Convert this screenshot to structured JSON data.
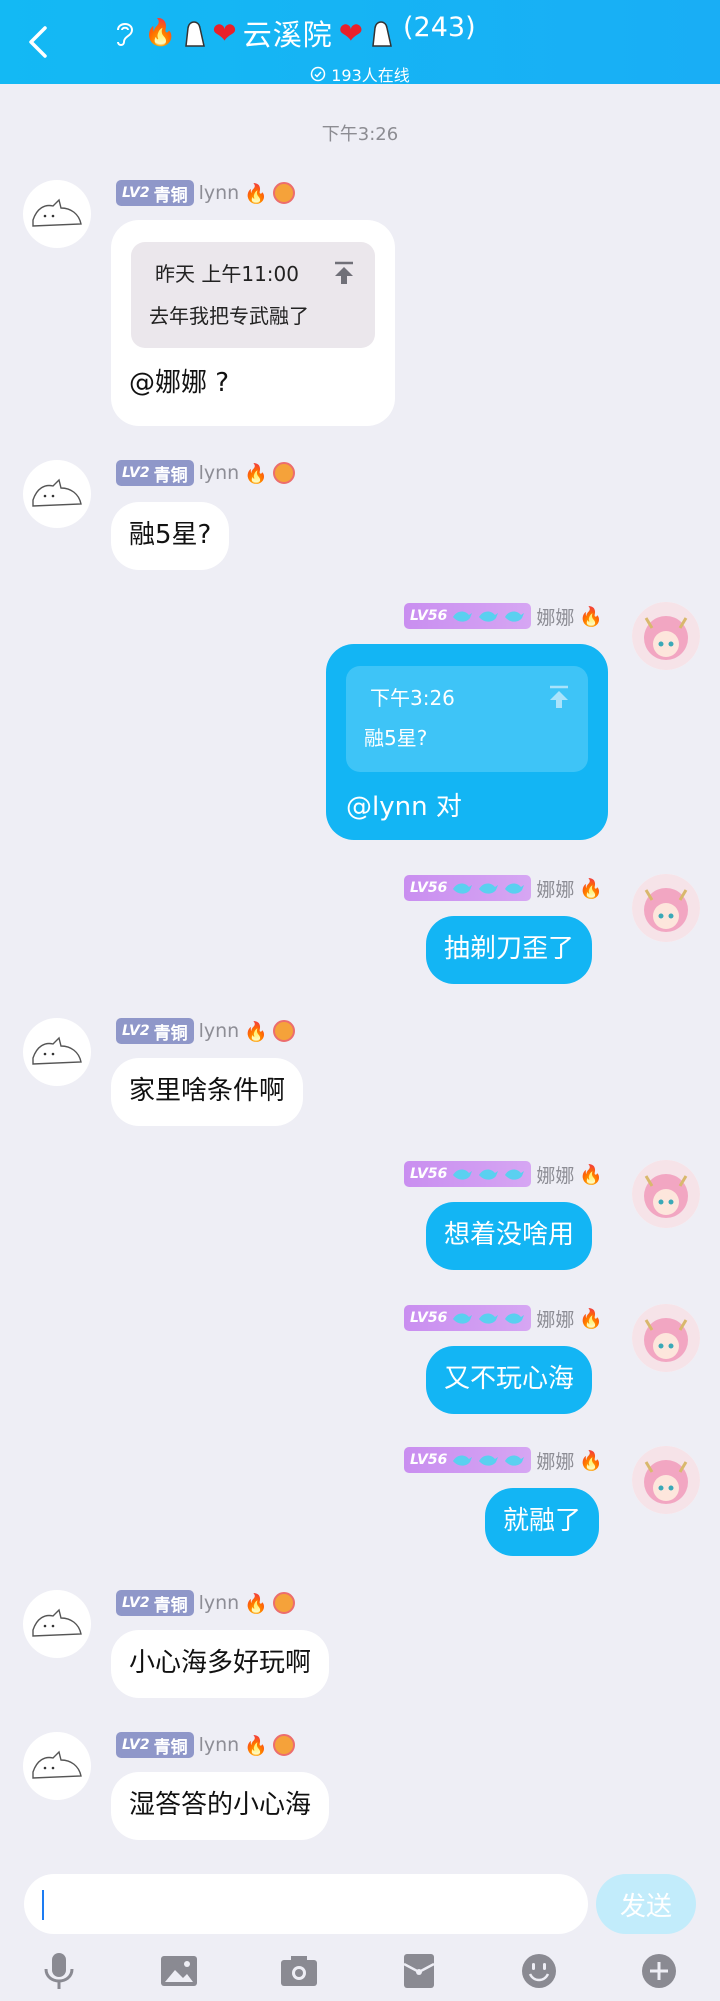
{
  "header": {
    "title": "云溪院",
    "member_count": "(243)",
    "online": "193人在线"
  },
  "timestamp": "下午3:26",
  "users": {
    "lynn": {
      "name": "lynn",
      "level": "LV2",
      "rank": "青铜"
    },
    "nana": {
      "name": "娜娜",
      "level": "LV56"
    }
  },
  "messages": [
    {
      "sender": "lynn",
      "quote_time": "昨天 上午11:00",
      "quote_text": "去年我把专武融了",
      "text": "@娜娜 ?"
    },
    {
      "sender": "lynn",
      "text": "融5星?"
    },
    {
      "sender": "nana",
      "quote_time": "下午3:26",
      "quote_text": "融5星?",
      "text": "@lynn 对"
    },
    {
      "sender": "nana",
      "text": "抽剃刀歪了"
    },
    {
      "sender": "lynn",
      "text": "家里啥条件啊"
    },
    {
      "sender": "nana",
      "text": "想着没啥用"
    },
    {
      "sender": "nana",
      "text": "又不玩心海"
    },
    {
      "sender": "nana",
      "text": "就融了"
    },
    {
      "sender": "lynn",
      "text": "小心海多好玩啊"
    },
    {
      "sender": "lynn",
      "text": "湿答答的小心海"
    }
  ],
  "composer": {
    "input_value": "",
    "send_label": "发送"
  },
  "toolbar": [
    "microphone-icon",
    "image-icon",
    "camera-icon",
    "red-packet-icon",
    "emoji-icon",
    "plus-icon"
  ],
  "colors": {
    "header": "#13b9f4",
    "self_bubble": "#13b5f4",
    "background": "#eeeef5",
    "send_button": "#c2ecfb"
  }
}
